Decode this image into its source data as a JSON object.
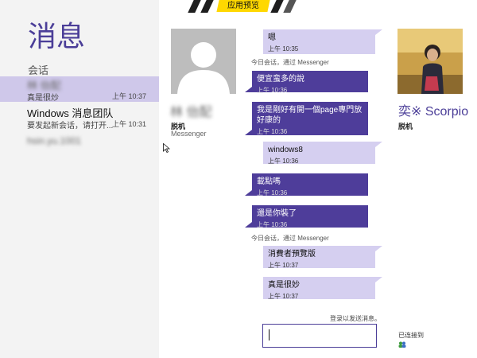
{
  "app": {
    "title": "消息",
    "banner_label": "应用预览"
  },
  "sidebar": {
    "section_label": "会话",
    "conversations": [
      {
        "name": "林 佁配",
        "snippet": "真是很炒",
        "time": "上午 10:37"
      },
      {
        "name": "Windows 消息团队",
        "snippet": "要发起新会话，请打开...",
        "time": "上午 10:31"
      }
    ],
    "extra_contact": "hsin.yu.1001"
  },
  "contact_left": {
    "name": "林 佁配",
    "status": "脱机",
    "service": "Messenger"
  },
  "contact_right": {
    "name": "奕※ Scorpio",
    "status": "脱机"
  },
  "messages": [
    {
      "text": "嗯",
      "time": "上午 10:35",
      "dir": "in"
    },
    {
      "separator": "今日会话，通过 Messenger"
    },
    {
      "text": "便宜蛮多的說",
      "time": "上午 10:36",
      "dir": "out"
    },
    {
      "text": "我是剛好有開一個page專門放好康的",
      "time": "上午 10:36",
      "dir": "out"
    },
    {
      "text": "windows8",
      "time": "上午 10:36",
      "dir": "in"
    },
    {
      "text": "載點嗎",
      "time": "上午 10:36",
      "dir": "out"
    },
    {
      "text": "還是你裝了",
      "time": "上午 10:36",
      "dir": "out"
    },
    {
      "separator": "今日会话，通过 Messenger"
    },
    {
      "text": "消費者預覽版",
      "time": "上午 10:37",
      "dir": "in"
    },
    {
      "text": "真是很妙",
      "time": "上午 10:37",
      "dir": "in"
    }
  ],
  "compose": {
    "hint": "登录以发送消息。",
    "value": ""
  },
  "connection": {
    "status": "已连接到"
  },
  "colors": {
    "accent": "#4b3e98",
    "bubble_in": "#d5cff0",
    "bubble_out": "#4e3d9a",
    "banner": "#ffd800"
  }
}
